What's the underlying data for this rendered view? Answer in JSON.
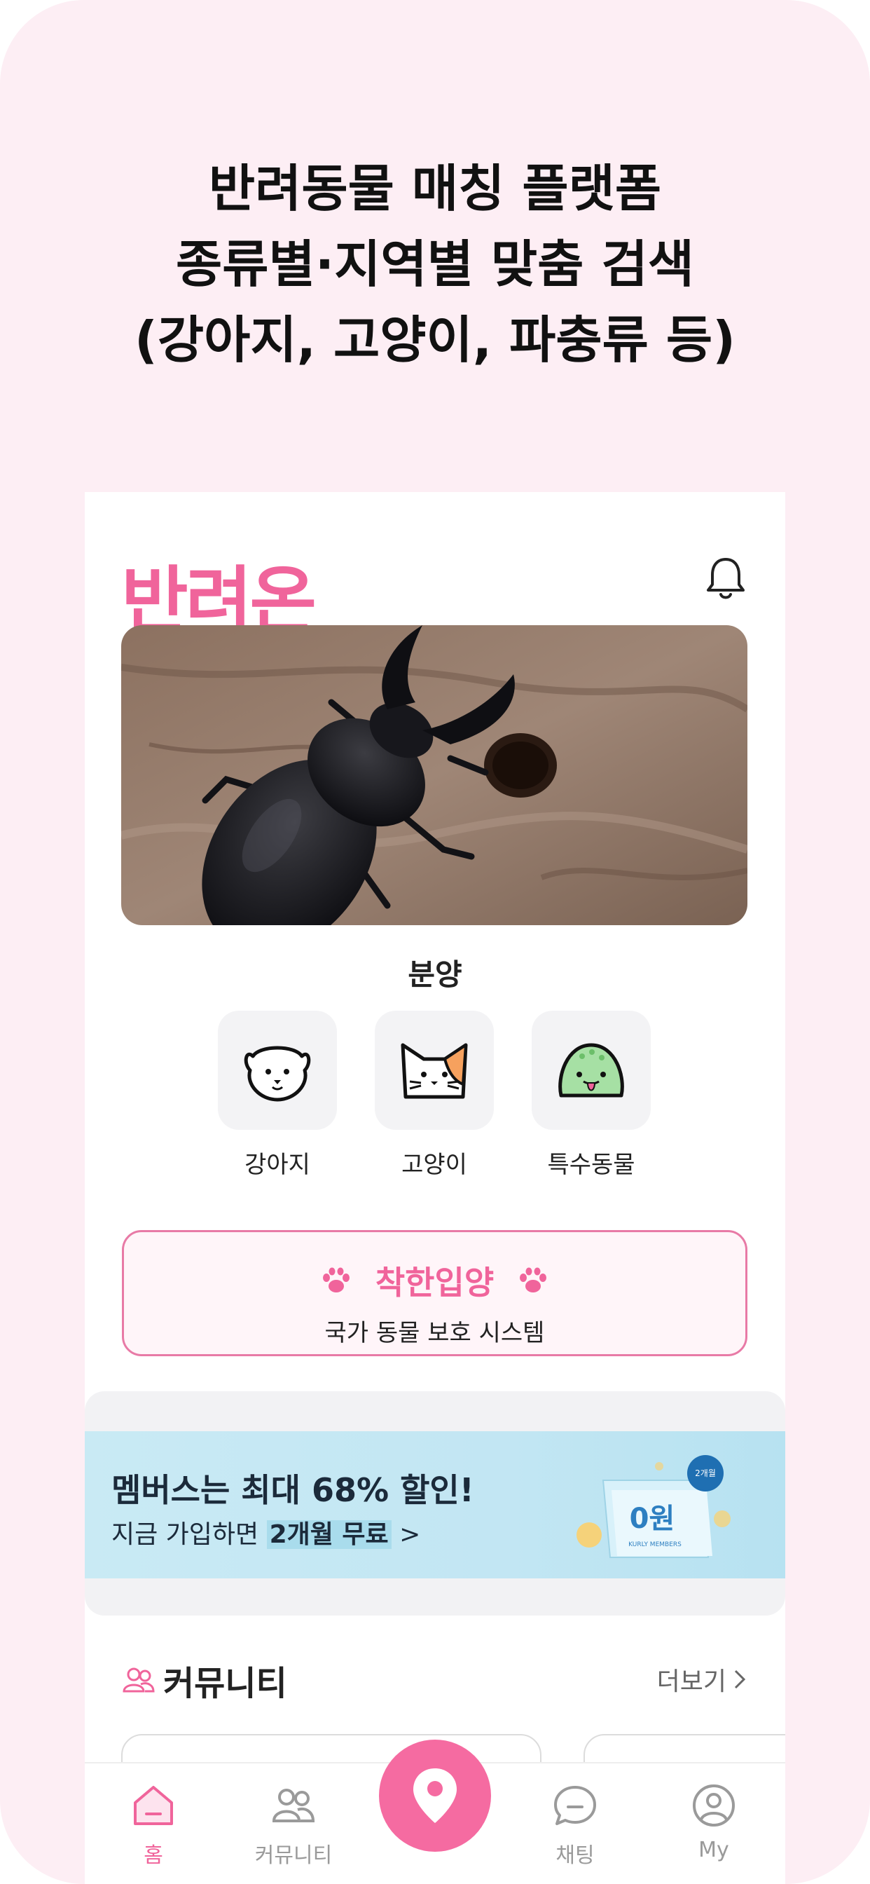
{
  "headline": {
    "line1": "반려동물 매칭 플랫폼",
    "line2": "종류별·지역별 맞춤 검색",
    "line3": "(강아지, 고양이, 파충류 등)"
  },
  "app": {
    "logo": "반려온",
    "bell_icon": "bell-icon"
  },
  "hero": {
    "image": "stag-beetle-photo"
  },
  "adoption": {
    "title": "분양",
    "categories": [
      {
        "label": "강아지",
        "icon": "dog-face-icon"
      },
      {
        "label": "고양이",
        "icon": "cat-face-icon"
      },
      {
        "label": "특수동물",
        "icon": "green-creature-icon"
      }
    ]
  },
  "good_adopt": {
    "title": "착한입양",
    "subtitle": "국가 동물 보호 시스템",
    "icon": "paw-icon"
  },
  "banner": {
    "line1": "멤버스는 최대 68% 할인!",
    "line2_prefix": "지금 가입하면 ",
    "line2_highlight": "2개월 무료",
    "line2_suffix": " >",
    "card_value": "0원",
    "card_badge": "2개월",
    "card_caption": "KURLY MEMBERS"
  },
  "community": {
    "title": "커뮤니티",
    "more": "더보기",
    "icon": "people-icon"
  },
  "tabbar": {
    "tabs": [
      {
        "label": "홈",
        "icon": "home-icon",
        "active": true
      },
      {
        "label": "커뮤니티",
        "icon": "people-icon",
        "active": false
      },
      {
        "label": "채팅",
        "icon": "chat-icon",
        "active": false
      },
      {
        "label": "My",
        "icon": "profile-icon",
        "active": false
      }
    ],
    "center_icon": "location-pin-icon"
  },
  "colors": {
    "brand_pink": "#f0649b",
    "background_pink": "#fdeef4",
    "banner_blue": "#c2e6f3"
  }
}
